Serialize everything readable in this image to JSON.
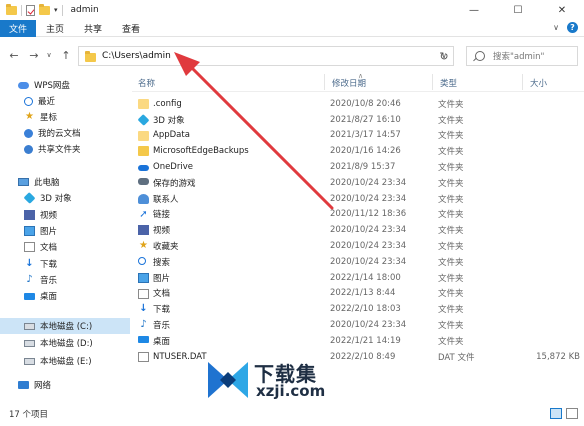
{
  "window": {
    "title": "admin",
    "minimize": "—",
    "maximize": "☐",
    "close": "✕"
  },
  "ribbon": {
    "tabs": [
      "文件",
      "主页",
      "共享",
      "查看"
    ]
  },
  "address": {
    "path": "C:\\Users\\admin",
    "search_placeholder": "搜索\"admin\""
  },
  "nav": {
    "items": [
      {
        "label": "WPS网盘",
        "icon": "wps-cloud-icon"
      },
      {
        "label": "最近",
        "icon": "recent-icon"
      },
      {
        "label": "星标",
        "icon": "star-icon"
      },
      {
        "label": "我的云文档",
        "icon": "cloud-doc-icon"
      },
      {
        "label": "共享文件夹",
        "icon": "shared-folder-icon"
      },
      {
        "label": "此电脑",
        "icon": "this-pc-icon"
      },
      {
        "label": "3D 对象",
        "icon": "3d-objects-icon"
      },
      {
        "label": "视频",
        "icon": "videos-icon"
      },
      {
        "label": "图片",
        "icon": "pictures-icon"
      },
      {
        "label": "文档",
        "icon": "documents-icon"
      },
      {
        "label": "下载",
        "icon": "downloads-icon"
      },
      {
        "label": "音乐",
        "icon": "music-icon"
      },
      {
        "label": "桌面",
        "icon": "desktop-icon"
      },
      {
        "label": "本地磁盘 (C:)",
        "icon": "drive-c-icon"
      },
      {
        "label": "本地磁盘 (D:)",
        "icon": "drive-d-icon"
      },
      {
        "label": "本地磁盘 (E:)",
        "icon": "drive-e-icon"
      },
      {
        "label": "网络",
        "icon": "network-icon"
      }
    ]
  },
  "columns": {
    "name": "名称",
    "date": "修改日期",
    "type": "类型",
    "size": "大小"
  },
  "files": [
    {
      "name": ".config",
      "date": "2020/10/8 20:46",
      "type": "文件夹",
      "size": "",
      "icon": "folder-icon"
    },
    {
      "name": "3D 对象",
      "date": "2021/8/27 16:10",
      "type": "文件夹",
      "size": "",
      "icon": "3d-objects-icon"
    },
    {
      "name": "AppData",
      "date": "2021/3/17 14:57",
      "type": "文件夹",
      "size": "",
      "icon": "folder-icon"
    },
    {
      "name": "MicrosoftEdgeBackups",
      "date": "2020/1/16 14:26",
      "type": "文件夹",
      "size": "",
      "icon": "folder-icon"
    },
    {
      "name": "OneDrive",
      "date": "2021/8/9 15:37",
      "type": "文件夹",
      "size": "",
      "icon": "onedrive-icon"
    },
    {
      "name": "保存的游戏",
      "date": "2020/10/24 23:34",
      "type": "文件夹",
      "size": "",
      "icon": "saved-games-icon"
    },
    {
      "name": "联系人",
      "date": "2020/10/24 23:34",
      "type": "文件夹",
      "size": "",
      "icon": "contacts-icon"
    },
    {
      "name": "链接",
      "date": "2020/11/12 18:36",
      "type": "文件夹",
      "size": "",
      "icon": "links-icon"
    },
    {
      "name": "视频",
      "date": "2020/10/24 23:34",
      "type": "文件夹",
      "size": "",
      "icon": "videos-icon"
    },
    {
      "name": "收藏夹",
      "date": "2020/10/24 23:34",
      "type": "文件夹",
      "size": "",
      "icon": "favorites-icon"
    },
    {
      "name": "搜索",
      "date": "2020/10/24 23:34",
      "type": "文件夹",
      "size": "",
      "icon": "searches-icon"
    },
    {
      "name": "图片",
      "date": "2022/1/14 18:00",
      "type": "文件夹",
      "size": "",
      "icon": "pictures-icon"
    },
    {
      "name": "文档",
      "date": "2022/1/13 8:44",
      "type": "文件夹",
      "size": "",
      "icon": "documents-icon"
    },
    {
      "name": "下载",
      "date": "2022/2/10 18:03",
      "type": "文件夹",
      "size": "",
      "icon": "downloads-icon"
    },
    {
      "name": "音乐",
      "date": "2020/10/24 23:34",
      "type": "文件夹",
      "size": "",
      "icon": "music-icon"
    },
    {
      "name": "桌面",
      "date": "2022/1/21 14:19",
      "type": "文件夹",
      "size": "",
      "icon": "desktop-icon"
    },
    {
      "name": "NTUSER.DAT",
      "date": "2022/2/10 8:49",
      "type": "DAT 文件",
      "size": "15,872 KB",
      "icon": "dat-file-icon"
    }
  ],
  "status": {
    "count": "17 个项目"
  },
  "watermark": {
    "text": "下载集",
    "url": "xzji.com"
  },
  "colors": {
    "accent": "#1979ca",
    "selection": "#cce4f7",
    "arrow": "#e03a3e"
  }
}
